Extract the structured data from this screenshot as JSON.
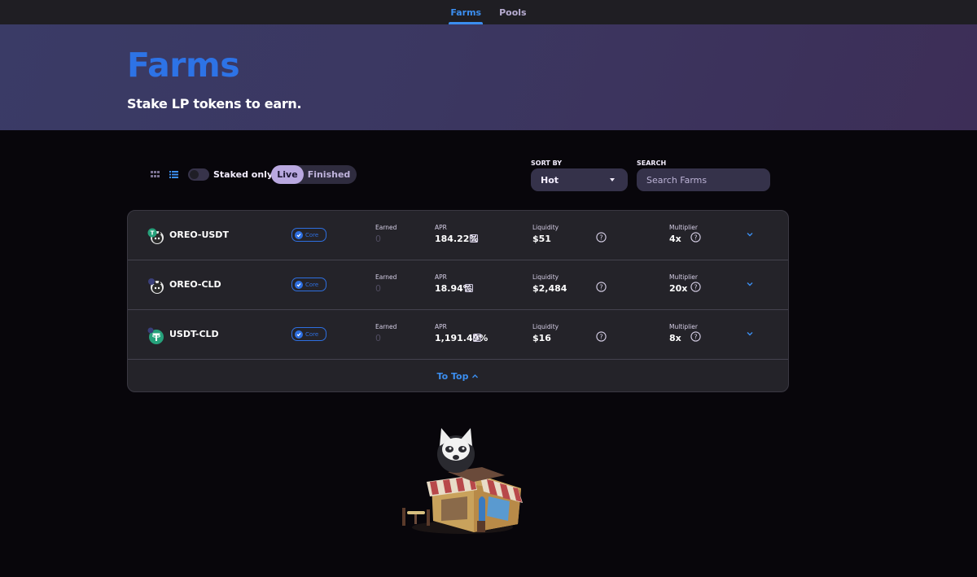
{
  "nav": {
    "tabs": [
      {
        "label": "Farms",
        "active": true
      },
      {
        "label": "Pools",
        "active": false
      }
    ]
  },
  "hero": {
    "title": "Farms",
    "subtitle": "Stake LP tokens to earn."
  },
  "controls": {
    "staked_only_label": "Staked only",
    "staked_only": false,
    "status_options": [
      "Live",
      "Finished"
    ],
    "status_selected": "Live",
    "sort_label": "SORT BY",
    "sort_value": "Hot",
    "search_label": "SEARCH",
    "search_placeholder": "Search Farms",
    "search_value": ""
  },
  "farms": {
    "labels": {
      "earned": "Earned",
      "apr": "APR",
      "liquidity": "Liquidity",
      "multiplier": "Multiplier",
      "badge": "Core"
    },
    "rows": [
      {
        "pair": "OREO-USDT",
        "earned": "0",
        "apr": "184.22%",
        "liquidity": "$51",
        "multiplier": "4x"
      },
      {
        "pair": "OREO-CLD",
        "earned": "0",
        "apr": "18.94%",
        "liquidity": "$2,484",
        "multiplier": "20x"
      },
      {
        "pair": "USDT-CLD",
        "earned": "0",
        "apr": "1,191.49%",
        "liquidity": "$16",
        "multiplier": "8x"
      }
    ],
    "to_top_label": "To Top"
  },
  "colors": {
    "accent": "#3b8ef0",
    "title_blue": "#2d73e6",
    "badge_blue": "#2e6fe0",
    "tether_green": "#26a17b"
  },
  "icons": [
    "grid-view-icon",
    "list-view-icon",
    "caret-down-icon",
    "check-badge-icon",
    "calculator-icon",
    "help-icon",
    "chevron-down-icon",
    "chevron-up-icon",
    "tether-icon",
    "oreo-mascot-icon"
  ]
}
